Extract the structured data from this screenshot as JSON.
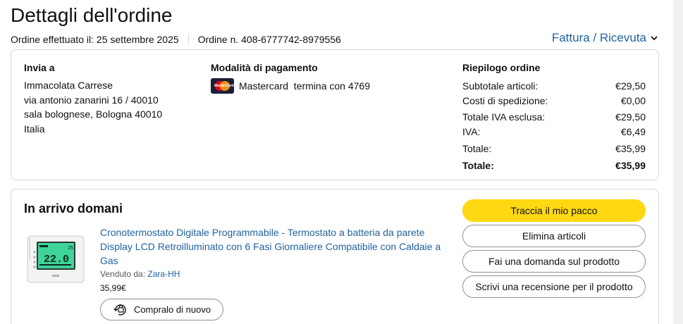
{
  "page": {
    "title": "Dettagli dell'ordine",
    "order_date": "Ordine effettuato il: 25 settembre 2025",
    "order_number": "Ordine n. 408-6777742-8979556",
    "invoice_link": "Fattura / Ricevuta"
  },
  "shipping": {
    "heading": "Invia a",
    "lines": [
      "Immacolata Carrese",
      "via antonio zanarini 16 / 40010",
      "sala bolognese, Bologna 40010",
      "Italia"
    ]
  },
  "payment": {
    "heading": "Modalità di pagamento",
    "card_logo_text": "MasterCard",
    "card_text": "Mastercard  termina con 4769"
  },
  "summary": {
    "heading": "Riepilogo ordine",
    "rows": [
      {
        "label": "Subtotale articoli:",
        "value": "€29,50"
      },
      {
        "label": "Costi di spedizione:",
        "value": "€0,00"
      },
      {
        "label": "Totale IVA esclusa:",
        "value": "€29,50"
      },
      {
        "label": "IVA:",
        "value": "€6,49"
      },
      {
        "label": "Totale:",
        "value": "€35,99"
      },
      {
        "label": "Totale:",
        "value": "€35,99"
      }
    ]
  },
  "shipment": {
    "status": "In arrivo domani",
    "product": {
      "title": "Cronotermostato Digitale Programmabile - Termostato a batteria da parete Display LCD Retroilluminato con 6 Fasi Giornaliere Compatibile con Caldaie a Gas",
      "sold_by_label": "Venduto da:",
      "seller": "Zara-HH",
      "price": "35,99€",
      "display_temp": "22.0",
      "display_small": "25"
    },
    "rebuy_label": "Compralo di nuovo",
    "actions": {
      "track": "Traccia il mio pacco",
      "remove": "Elimina articoli",
      "question": "Fai una domanda sul prodotto",
      "review": "Scrivi una recensione per il prodotto"
    }
  },
  "colors": {
    "link": "#2162a1",
    "primary_button": "#ffd814",
    "border": "#d5d9d9"
  }
}
